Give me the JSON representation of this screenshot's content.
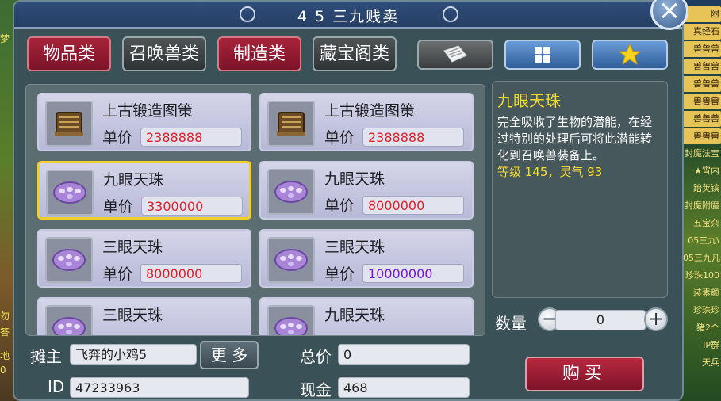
{
  "window": {
    "title": "4 5 三九贱卖",
    "close_icon": "close-icon"
  },
  "tabs": [
    {
      "label": "物品类",
      "active": true
    },
    {
      "label": "召唤兽类",
      "active": false
    },
    {
      "label": "制造类",
      "active": true
    },
    {
      "label": "藏宝阁类",
      "active": false
    }
  ],
  "icon_tabs": [
    {
      "icon": "notebook-icon"
    },
    {
      "icon": "grid-icon"
    },
    {
      "icon": "star-icon"
    }
  ],
  "items": [
    {
      "name": "上古锻造图策",
      "price_label": "单价",
      "price": "2388888",
      "price_color": "red",
      "icon": "scroll-icon",
      "selected": false
    },
    {
      "name": "上古锻造图策",
      "price_label": "单价",
      "price": "2388888",
      "price_color": "red",
      "icon": "scroll-icon",
      "selected": false
    },
    {
      "name": "九眼天珠",
      "price_label": "单价",
      "price": "3300000",
      "price_color": "red",
      "icon": "bead-icon",
      "selected": true
    },
    {
      "name": "九眼天珠",
      "price_label": "单价",
      "price": "8000000",
      "price_color": "red",
      "icon": "bead-icon",
      "selected": false
    },
    {
      "name": "三眼天珠",
      "price_label": "单价",
      "price": "8000000",
      "price_color": "red",
      "icon": "bead-icon",
      "selected": false
    },
    {
      "name": "三眼天珠",
      "price_label": "单价",
      "price": "10000000",
      "price_color": "purple",
      "icon": "bead-icon",
      "selected": false
    },
    {
      "name": "三眼天珠",
      "price_label": "",
      "price": "",
      "price_color": "red",
      "icon": "bead-icon",
      "selected": false
    },
    {
      "name": "九眼天珠",
      "price_label": "",
      "price": "",
      "price_color": "red",
      "icon": "bead-icon",
      "selected": false
    }
  ],
  "description": {
    "title": "九眼天珠",
    "body": "完全吸收了生物的潜能，在经过特别的处理后可将此潜能转化到召唤兽装备上。",
    "stats": "等级 145，灵气 93"
  },
  "quantity": {
    "label": "数量",
    "value": "0",
    "minus": "−",
    "plus": "+"
  },
  "seller": {
    "owner_label": "摊主",
    "owner": "飞奔的小鸡5",
    "more_label": "更 多",
    "id_label": "ID",
    "id": "47233963"
  },
  "totals": {
    "total_label": "总价",
    "total": "0",
    "cash_label": "现金",
    "cash": "468"
  },
  "buy_label": "购买",
  "colors": {
    "title_bar": "#2f4e7b",
    "tab_active": "#a8233a",
    "selected_border": "#f1cf2a",
    "price_red": "#e21f2a",
    "price_purple": "#7b16d8",
    "description_highlight": "#f5dd30"
  },
  "background_sidebar": [
    "附",
    "真经石",
    "兽兽兽",
    "兽兽兽",
    "兽兽兽",
    "兽兽兽",
    "兽兽兽",
    "兽兽兽",
    "封魔法宝",
    "★宵内",
    "跆荚镔",
    "封魔附魔",
    "五宝杂",
    "05三九\\",
    "05三九凡",
    "珍珠100",
    "装素颜",
    "珍珠珍",
    "猪2个",
    "IP群",
    "天兵"
  ],
  "background_left": [
    "梦",
    "勿",
    "答",
    "地",
    "0"
  ]
}
